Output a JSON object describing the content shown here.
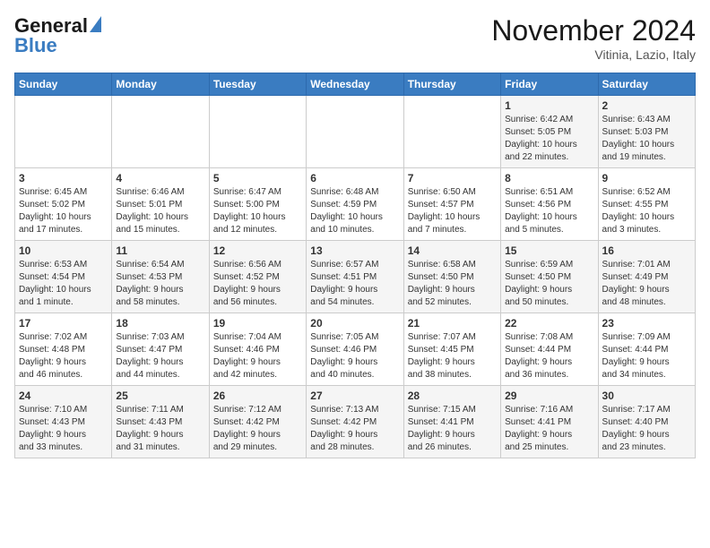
{
  "header": {
    "logo_general": "General",
    "logo_blue": "Blue",
    "month_title": "November 2024",
    "location": "Vitinia, Lazio, Italy"
  },
  "days_of_week": [
    "Sunday",
    "Monday",
    "Tuesday",
    "Wednesday",
    "Thursday",
    "Friday",
    "Saturday"
  ],
  "weeks": [
    [
      {
        "day": "",
        "info": ""
      },
      {
        "day": "",
        "info": ""
      },
      {
        "day": "",
        "info": ""
      },
      {
        "day": "",
        "info": ""
      },
      {
        "day": "",
        "info": ""
      },
      {
        "day": "1",
        "info": "Sunrise: 6:42 AM\nSunset: 5:05 PM\nDaylight: 10 hours\nand 22 minutes."
      },
      {
        "day": "2",
        "info": "Sunrise: 6:43 AM\nSunset: 5:03 PM\nDaylight: 10 hours\nand 19 minutes."
      }
    ],
    [
      {
        "day": "3",
        "info": "Sunrise: 6:45 AM\nSunset: 5:02 PM\nDaylight: 10 hours\nand 17 minutes."
      },
      {
        "day": "4",
        "info": "Sunrise: 6:46 AM\nSunset: 5:01 PM\nDaylight: 10 hours\nand 15 minutes."
      },
      {
        "day": "5",
        "info": "Sunrise: 6:47 AM\nSunset: 5:00 PM\nDaylight: 10 hours\nand 12 minutes."
      },
      {
        "day": "6",
        "info": "Sunrise: 6:48 AM\nSunset: 4:59 PM\nDaylight: 10 hours\nand 10 minutes."
      },
      {
        "day": "7",
        "info": "Sunrise: 6:50 AM\nSunset: 4:57 PM\nDaylight: 10 hours\nand 7 minutes."
      },
      {
        "day": "8",
        "info": "Sunrise: 6:51 AM\nSunset: 4:56 PM\nDaylight: 10 hours\nand 5 minutes."
      },
      {
        "day": "9",
        "info": "Sunrise: 6:52 AM\nSunset: 4:55 PM\nDaylight: 10 hours\nand 3 minutes."
      }
    ],
    [
      {
        "day": "10",
        "info": "Sunrise: 6:53 AM\nSunset: 4:54 PM\nDaylight: 10 hours\nand 1 minute."
      },
      {
        "day": "11",
        "info": "Sunrise: 6:54 AM\nSunset: 4:53 PM\nDaylight: 9 hours\nand 58 minutes."
      },
      {
        "day": "12",
        "info": "Sunrise: 6:56 AM\nSunset: 4:52 PM\nDaylight: 9 hours\nand 56 minutes."
      },
      {
        "day": "13",
        "info": "Sunrise: 6:57 AM\nSunset: 4:51 PM\nDaylight: 9 hours\nand 54 minutes."
      },
      {
        "day": "14",
        "info": "Sunrise: 6:58 AM\nSunset: 4:50 PM\nDaylight: 9 hours\nand 52 minutes."
      },
      {
        "day": "15",
        "info": "Sunrise: 6:59 AM\nSunset: 4:50 PM\nDaylight: 9 hours\nand 50 minutes."
      },
      {
        "day": "16",
        "info": "Sunrise: 7:01 AM\nSunset: 4:49 PM\nDaylight: 9 hours\nand 48 minutes."
      }
    ],
    [
      {
        "day": "17",
        "info": "Sunrise: 7:02 AM\nSunset: 4:48 PM\nDaylight: 9 hours\nand 46 minutes."
      },
      {
        "day": "18",
        "info": "Sunrise: 7:03 AM\nSunset: 4:47 PM\nDaylight: 9 hours\nand 44 minutes."
      },
      {
        "day": "19",
        "info": "Sunrise: 7:04 AM\nSunset: 4:46 PM\nDaylight: 9 hours\nand 42 minutes."
      },
      {
        "day": "20",
        "info": "Sunrise: 7:05 AM\nSunset: 4:46 PM\nDaylight: 9 hours\nand 40 minutes."
      },
      {
        "day": "21",
        "info": "Sunrise: 7:07 AM\nSunset: 4:45 PM\nDaylight: 9 hours\nand 38 minutes."
      },
      {
        "day": "22",
        "info": "Sunrise: 7:08 AM\nSunset: 4:44 PM\nDaylight: 9 hours\nand 36 minutes."
      },
      {
        "day": "23",
        "info": "Sunrise: 7:09 AM\nSunset: 4:44 PM\nDaylight: 9 hours\nand 34 minutes."
      }
    ],
    [
      {
        "day": "24",
        "info": "Sunrise: 7:10 AM\nSunset: 4:43 PM\nDaylight: 9 hours\nand 33 minutes."
      },
      {
        "day": "25",
        "info": "Sunrise: 7:11 AM\nSunset: 4:43 PM\nDaylight: 9 hours\nand 31 minutes."
      },
      {
        "day": "26",
        "info": "Sunrise: 7:12 AM\nSunset: 4:42 PM\nDaylight: 9 hours\nand 29 minutes."
      },
      {
        "day": "27",
        "info": "Sunrise: 7:13 AM\nSunset: 4:42 PM\nDaylight: 9 hours\nand 28 minutes."
      },
      {
        "day": "28",
        "info": "Sunrise: 7:15 AM\nSunset: 4:41 PM\nDaylight: 9 hours\nand 26 minutes."
      },
      {
        "day": "29",
        "info": "Sunrise: 7:16 AM\nSunset: 4:41 PM\nDaylight: 9 hours\nand 25 minutes."
      },
      {
        "day": "30",
        "info": "Sunrise: 7:17 AM\nSunset: 4:40 PM\nDaylight: 9 hours\nand 23 minutes."
      }
    ]
  ]
}
